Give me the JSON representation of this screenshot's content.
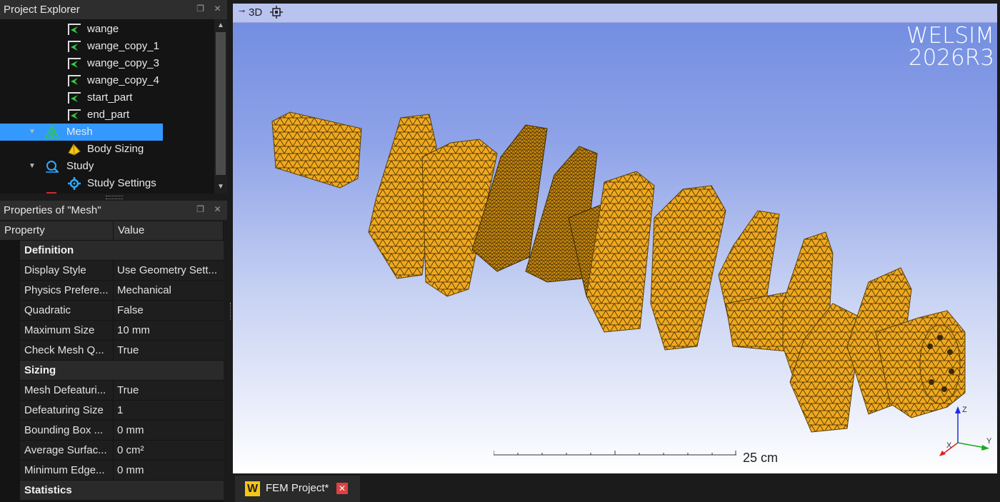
{
  "explorer": {
    "title": "Project Explorer",
    "items": [
      {
        "label": "wange"
      },
      {
        "label": "wange_copy_1"
      },
      {
        "label": "wange_copy_3"
      },
      {
        "label": "wange_copy_4"
      },
      {
        "label": "start_part"
      },
      {
        "label": "end_part"
      },
      {
        "label": "Mesh",
        "selected": true,
        "expanded": true
      },
      {
        "label": "Body Sizing"
      },
      {
        "label": "Study",
        "expanded": true
      },
      {
        "label": "Study Settings"
      }
    ]
  },
  "properties": {
    "title": "Properties of \"Mesh\"",
    "columns": [
      "Property",
      "Value"
    ],
    "sections": [
      {
        "name": "Definition",
        "rows": [
          {
            "key": "Display Style",
            "value": "Use Geometry Sett..."
          },
          {
            "key": "Physics Prefere...",
            "value": "Mechanical"
          },
          {
            "key": "Quadratic",
            "value": "False"
          },
          {
            "key": "Maximum Size",
            "value": "10 mm"
          },
          {
            "key": "Check Mesh Q...",
            "value": "True"
          }
        ]
      },
      {
        "name": "Sizing",
        "rows": [
          {
            "key": "Mesh Defeaturi...",
            "value": "True"
          },
          {
            "key": "Defeaturing Size",
            "value": "1"
          },
          {
            "key": "Bounding Box ...",
            "value": "0 mm"
          },
          {
            "key": "Average Surfac...",
            "value": "0 cm²"
          },
          {
            "key": "Minimum Edge...",
            "value": "0 mm"
          }
        ]
      },
      {
        "name": "Statistics",
        "rows": []
      }
    ]
  },
  "viewport": {
    "view_label": "3D",
    "logo_line1": "WELSIM",
    "logo_line2": "2026R3",
    "scale_label": "25 cm",
    "axes": {
      "x": "X",
      "y": "Y",
      "z": "Z"
    },
    "mesh_color": "#f0a81e"
  },
  "tabs": [
    {
      "label": "FEM Project*",
      "close": "✕"
    }
  ],
  "colors": {
    "selection": "#3399ff",
    "accent": "#f5c518"
  }
}
